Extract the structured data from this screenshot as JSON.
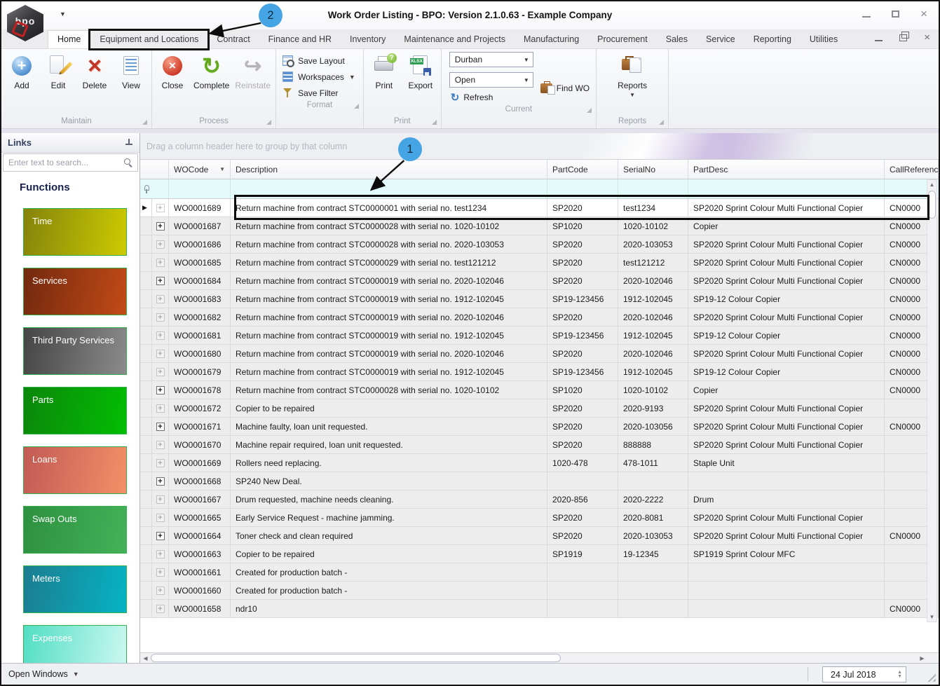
{
  "window": {
    "title": "Work Order Listing - BPO: Version 2.1.0.63 - Example Company",
    "logo_text": "bpo",
    "close_glyph": "×"
  },
  "tabs": {
    "active_index": 0,
    "boxed_index": 1,
    "items": [
      "Home",
      "Equipment and Locations",
      "Contract",
      "Finance and HR",
      "Inventory",
      "Maintenance and Projects",
      "Manufacturing",
      "Procurement",
      "Sales",
      "Service",
      "Reporting",
      "Utilities"
    ]
  },
  "ribbon": {
    "maintain": {
      "label": "Maintain",
      "add": "Add",
      "edit": "Edit",
      "delete": "Delete",
      "view": "View"
    },
    "process": {
      "label": "Process",
      "close": "Close",
      "complete": "Complete",
      "reinstate": "Reinstate"
    },
    "format": {
      "label": "Format",
      "save_layout": "Save Layout",
      "workspaces": "Workspaces",
      "save_filter": "Save Filter"
    },
    "print": {
      "label": "Print",
      "print": "Print",
      "export": "Export",
      "export_badge": "XLSX"
    },
    "current": {
      "label": "Current",
      "site_value": "Durban",
      "status_value": "Open",
      "find_wo": "Find WO",
      "refresh": "Refresh"
    },
    "reports": {
      "label": "Reports",
      "button": "Reports"
    }
  },
  "sidebar": {
    "header": "Links",
    "search_placeholder": "Enter text to search...",
    "functions_title": "Functions",
    "tiles": [
      {
        "label": "Time",
        "color_from": "#85830b",
        "color_to": "#cccb01"
      },
      {
        "label": "Services",
        "color_from": "#73290f",
        "color_to": "#c24a16"
      },
      {
        "label": "Third Party Services",
        "color_from": "#454545",
        "color_to": "#8b8b8b"
      },
      {
        "label": "Parts",
        "color_from": "#0b870b",
        "color_to": "#03bd03"
      },
      {
        "label": "Loans",
        "color_from": "#c25b55",
        "color_to": "#f29068"
      },
      {
        "label": "Swap Outs",
        "color_from": "#2d9140",
        "color_to": "#44b158"
      },
      {
        "label": "Meters",
        "color_from": "#1b7d90",
        "color_to": "#06b4c4"
      },
      {
        "label": "Expenses",
        "color_from": "#52dec4",
        "color_to": "#ccf8f0"
      }
    ]
  },
  "grid": {
    "groupby_hint": "Drag a column header here to group by that column",
    "columns": [
      "WOCode",
      "Description",
      "PartCode",
      "SerialNo",
      "PartDesc",
      "CallReference"
    ],
    "rows": [
      {
        "wo": "WO0001689",
        "desc": "Return machine from contract STC0000001 with serial no. test1234",
        "part": "SP2020",
        "serial": "test1234",
        "pdesc": "SP2020 Sprint Colour Multi Functional Copier",
        "ref": "CN0000",
        "children": false,
        "selected": true
      },
      {
        "wo": "WO0001687",
        "desc": "Return machine from contract STC0000028 with serial no. 1020-10102",
        "part": "SP1020",
        "serial": "1020-10102",
        "pdesc": "Copier",
        "ref": "CN0000",
        "children": true,
        "selected": false
      },
      {
        "wo": "WO0001686",
        "desc": "Return machine from contract STC0000028 with serial no. 2020-103053",
        "part": "SP2020",
        "serial": "2020-103053",
        "pdesc": "SP2020 Sprint Colour Multi Functional Copier",
        "ref": "CN0000",
        "children": false,
        "selected": false
      },
      {
        "wo": "WO0001685",
        "desc": "Return machine from contract STC0000029 with serial no. test121212",
        "part": "SP2020",
        "serial": "test121212",
        "pdesc": "SP2020 Sprint Colour Multi Functional Copier",
        "ref": "CN0000",
        "children": false,
        "selected": false
      },
      {
        "wo": "WO0001684",
        "desc": "Return machine from contract STC0000019 with serial no. 2020-102046",
        "part": "SP2020",
        "serial": "2020-102046",
        "pdesc": "SP2020 Sprint Colour Multi Functional Copier",
        "ref": "CN0000",
        "children": true,
        "selected": false
      },
      {
        "wo": "WO0001683",
        "desc": "Return machine from contract STC0000019 with serial no. 1912-102045",
        "part": "SP19-123456",
        "serial": "1912-102045",
        "pdesc": "SP19-12 Colour Copier",
        "ref": "CN0000",
        "children": false,
        "selected": false
      },
      {
        "wo": "WO0001682",
        "desc": "Return machine from contract STC0000019 with serial no. 2020-102046",
        "part": "SP2020",
        "serial": "2020-102046",
        "pdesc": "SP2020 Sprint Colour Multi Functional Copier",
        "ref": "CN0000",
        "children": false,
        "selected": false
      },
      {
        "wo": "WO0001681",
        "desc": "Return machine from contract STC0000019 with serial no. 1912-102045",
        "part": "SP19-123456",
        "serial": "1912-102045",
        "pdesc": "SP19-12 Colour Copier",
        "ref": "CN0000",
        "children": false,
        "selected": false
      },
      {
        "wo": "WO0001680",
        "desc": "Return machine from contract STC0000019 with serial no. 2020-102046",
        "part": "SP2020",
        "serial": "2020-102046",
        "pdesc": "SP2020 Sprint Colour Multi Functional Copier",
        "ref": "CN0000",
        "children": false,
        "selected": false
      },
      {
        "wo": "WO0001679",
        "desc": "Return machine from contract STC0000019 with serial no. 1912-102045",
        "part": "SP19-123456",
        "serial": "1912-102045",
        "pdesc": "SP19-12 Colour Copier",
        "ref": "CN0000",
        "children": false,
        "selected": false
      },
      {
        "wo": "WO0001678",
        "desc": "Return machine from contract STC0000028 with serial no. 1020-10102",
        "part": "SP1020",
        "serial": "1020-10102",
        "pdesc": "Copier",
        "ref": "CN0000",
        "children": true,
        "selected": false
      },
      {
        "wo": "WO0001672",
        "desc": "Copier to be repaired",
        "part": "SP2020",
        "serial": "2020-9193",
        "pdesc": "SP2020 Sprint Colour Multi Functional Copier",
        "ref": "",
        "children": false,
        "selected": false
      },
      {
        "wo": "WO0001671",
        "desc": "Machine faulty, loan unit requested.",
        "part": "SP2020",
        "serial": "2020-103056",
        "pdesc": "SP2020 Sprint Colour Multi Functional Copier",
        "ref": "CN0000",
        "children": true,
        "selected": false
      },
      {
        "wo": "WO0001670",
        "desc": "Machine repair required, loan unit requested.",
        "part": "SP2020",
        "serial": "888888",
        "pdesc": "SP2020 Sprint Colour Multi Functional Copier",
        "ref": "",
        "children": false,
        "selected": false
      },
      {
        "wo": "WO0001669",
        "desc": "Rollers need replacing.",
        "part": "1020-478",
        "serial": "478-1011",
        "pdesc": "Staple Unit",
        "ref": "",
        "children": false,
        "selected": false
      },
      {
        "wo": "WO0001668",
        "desc": "SP240 New Deal.",
        "part": "",
        "serial": "",
        "pdesc": "",
        "ref": "",
        "children": true,
        "selected": false
      },
      {
        "wo": "WO0001667",
        "desc": "Drum requested, machine needs cleaning.",
        "part": "2020-856",
        "serial": "2020-2222",
        "pdesc": "Drum",
        "ref": "",
        "children": false,
        "selected": false
      },
      {
        "wo": "WO0001665",
        "desc": "Early Service Request - machine jamming.",
        "part": "SP2020",
        "serial": "2020-8081",
        "pdesc": "SP2020 Sprint Colour Multi Functional Copier",
        "ref": "",
        "children": false,
        "selected": false
      },
      {
        "wo": "WO0001664",
        "desc": "Toner check and clean required",
        "part": "SP2020",
        "serial": "2020-103053",
        "pdesc": "SP2020 Sprint Colour Multi Functional Copier",
        "ref": "CN0000",
        "children": true,
        "selected": false
      },
      {
        "wo": "WO0001663",
        "desc": "Copier to be repaired",
        "part": "SP1919",
        "serial": "19-12345",
        "pdesc": "SP1919 Sprint Colour MFC",
        "ref": "",
        "children": false,
        "selected": false
      },
      {
        "wo": "WO0001661",
        "desc": "Created for production batch -",
        "part": "",
        "serial": "",
        "pdesc": "",
        "ref": "",
        "children": false,
        "selected": false
      },
      {
        "wo": "WO0001660",
        "desc": "Created for production batch -",
        "part": "",
        "serial": "",
        "pdesc": "",
        "ref": "",
        "children": false,
        "selected": false
      },
      {
        "wo": "WO0001658",
        "desc": "ndr10",
        "part": "",
        "serial": "",
        "pdesc": "",
        "ref": "CN0000",
        "children": false,
        "selected": false
      }
    ]
  },
  "statusbar": {
    "open_windows": "Open Windows",
    "date": "24 Jul 2018"
  },
  "annotations": {
    "badge_color": "#45a4e4",
    "callout_1": "1",
    "callout_2": "2"
  }
}
